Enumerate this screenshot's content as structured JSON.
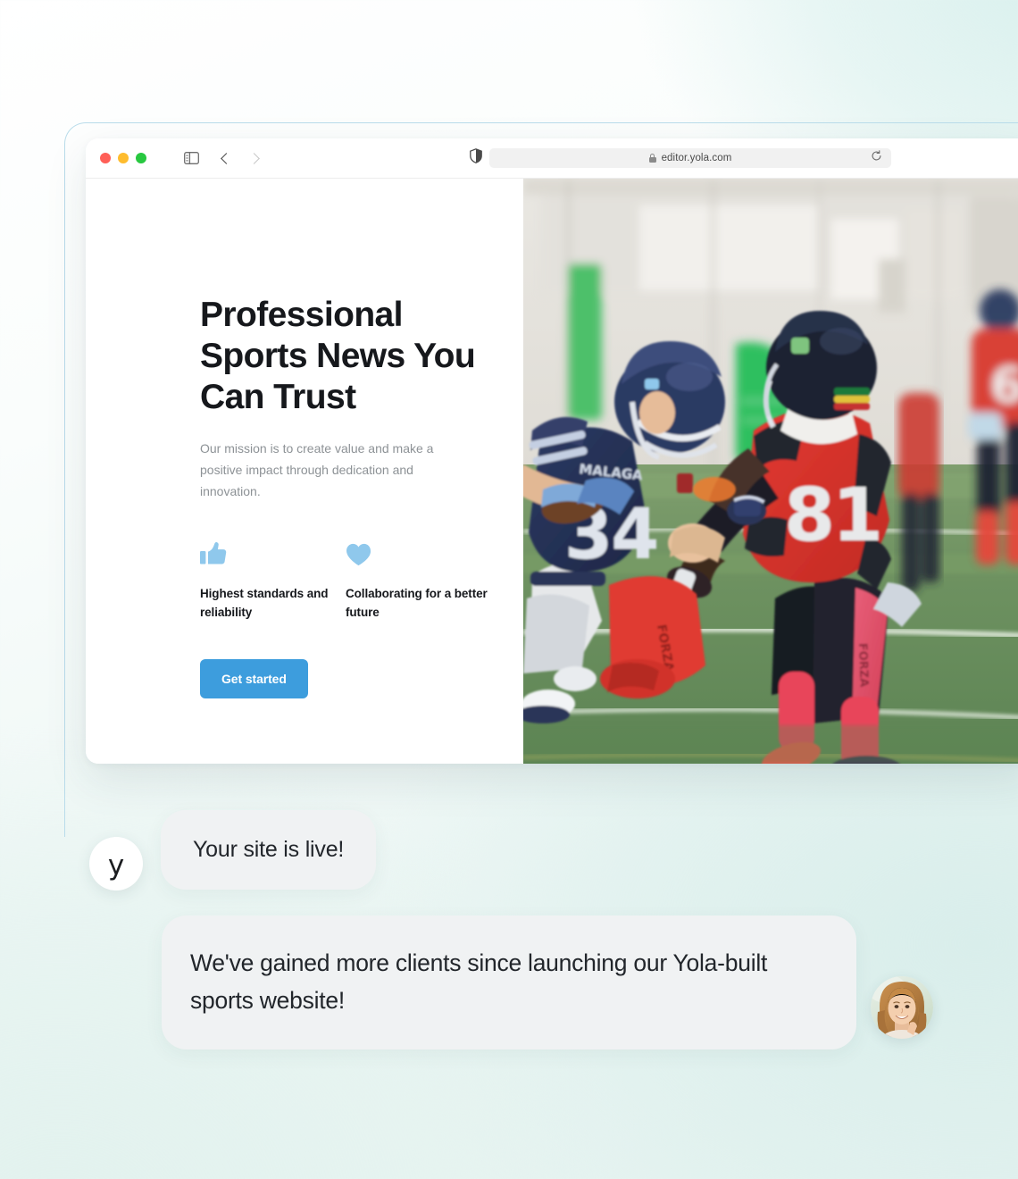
{
  "browser": {
    "url": "editor.yola.com",
    "icons": {
      "traffic_red": "close-window-dot",
      "traffic_yellow": "minimize-window-dot",
      "traffic_green": "maximize-window-dot",
      "sidebar": "sidebar-toggle-icon",
      "back": "chevron-left-icon",
      "forward": "chevron-right-icon",
      "shield": "shield-privacy-icon",
      "lock": "lock-icon",
      "reload": "reload-icon"
    },
    "colors": {
      "traffic_red": "#ff5f57",
      "traffic_yellow": "#febc2e",
      "traffic_green": "#28c840",
      "urlbar_bg": "#f1f1f1"
    }
  },
  "site": {
    "headline": "Professional Sports News You Can Trust",
    "subcopy": "Our mission is to create value and make a positive impact through dedication and innovation.",
    "features": [
      {
        "icon": "thumbs-up-icon",
        "label": "Highest standards and reliability"
      },
      {
        "icon": "heart-icon",
        "label": "Collaborating for a better future"
      }
    ],
    "cta_label": "Get started",
    "colors": {
      "accent": "#3d9ddd",
      "icon_blue": "#8fc8ec",
      "heading": "#16181c",
      "body_text": "#8d9296"
    },
    "photo_alt": "American football players on a green turf field, navy number 34 Malaga player carrying the ball beside a red number 81 player"
  },
  "chat": {
    "messages": [
      {
        "avatar": "yola-logo-avatar",
        "avatar_glyph": "y",
        "text": "Your site is live!"
      },
      {
        "avatar": "user-photo-avatar",
        "text": "We've gained more clients since launching our Yola-built sports website!"
      }
    ],
    "colors": {
      "bubble_bg": "#f0f2f3",
      "bubble_text": "#22262b"
    }
  },
  "background": {
    "colors": {
      "base": "#ffffff",
      "mint": "#e2f2ee",
      "teal": "#d6efec",
      "frame_border": "#b9dcea"
    }
  }
}
